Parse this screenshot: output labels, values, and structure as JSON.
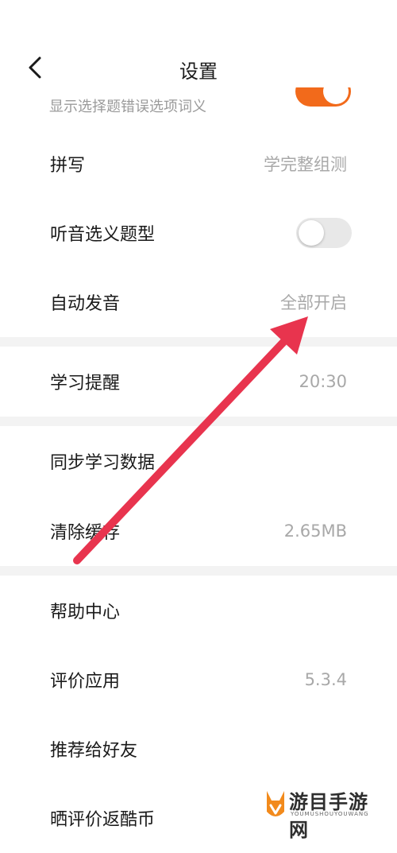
{
  "header": {
    "title": "设置"
  },
  "partial_row": {
    "subtitle": "显示选择题错误选项词义",
    "toggle_state": "on",
    "toggle_color": "#f26a1b"
  },
  "rows": {
    "spelling": {
      "label": "拼写",
      "value": "学完整组测"
    },
    "listening": {
      "label": "听音选义题型",
      "toggle_state": "off"
    },
    "auto_pronounce": {
      "label": "自动发音",
      "value": "全部开启"
    },
    "reminder": {
      "label": "学习提醒",
      "value": "20:30"
    },
    "sync": {
      "label": "同步学习数据"
    },
    "cache": {
      "label": "清除缓存",
      "value": "2.65MB"
    },
    "help": {
      "label": "帮助中心"
    },
    "rate": {
      "label": "评价应用",
      "value": "5.3.4"
    },
    "recommend": {
      "label": "推荐给好友"
    },
    "share_review": {
      "label": "晒评价返酷币"
    }
  },
  "annotation": {
    "arrow_color": "#e8344e"
  },
  "watermark": {
    "text": "游目手游网",
    "sub": "YOUMUSHOUYOUWANG"
  }
}
